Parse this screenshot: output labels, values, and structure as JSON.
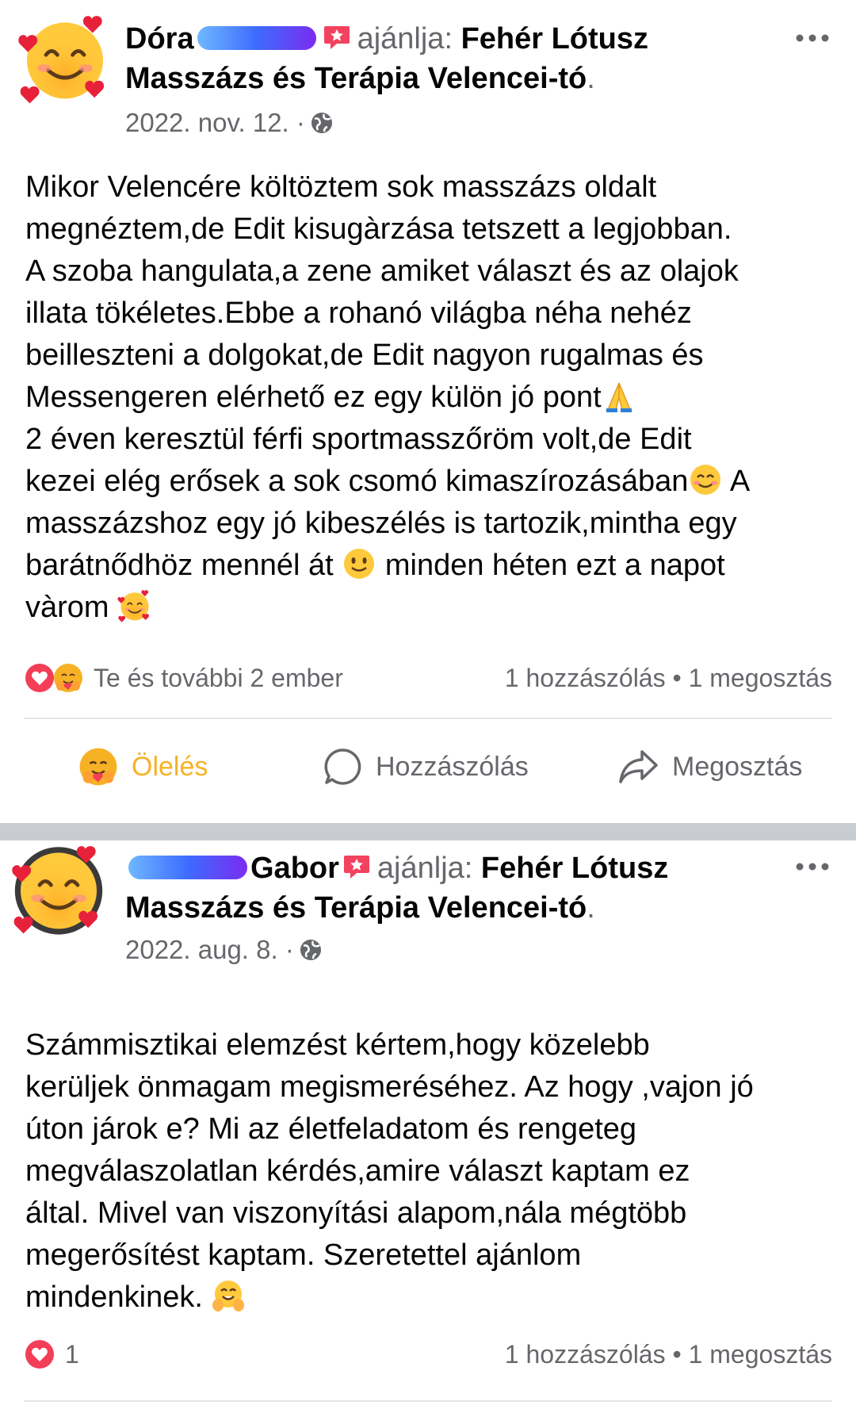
{
  "posts": [
    {
      "author_visible": "Dóra",
      "verb": "ajánlja:",
      "page": "Fehér Lótusz Masszázs és Terápia Velencei-tó",
      "end": ".",
      "date": "2022. nov. 12. ·",
      "body": [
        "Mikor Velencére költöztem sok masszázs oldalt",
        "megnéztem,de Edit kisugàrzása tetszett a legjobban.",
        "A szoba hangulata,a zene amiket választ és az olajok",
        "illata tökéletes.Ebbe a rohanó világba néha nehéz",
        "beilleszteni a dolgokat,de Edit nagyon rugalmas és",
        "Messengeren elérhető ez egy külön jó pont",
        "2 éven keresztül férfi sportmasszőröm volt,de Edit",
        "kezei elég erősek a sok csomó kimaszírozásában",
        "A",
        "masszázshoz egy jó kibeszélés is tartozik,mintha egy",
        "barátnődhöz mennél át",
        "minden héten ezt a napot",
        "vàrom"
      ],
      "reactions_text": "Te és további 2 ember",
      "comments": "1 hozzászólás",
      "bullet": "•",
      "shares": "1 megosztás",
      "actions": {
        "hug": "Ölelés",
        "comment": "Hozzászólás",
        "share": "Megosztás"
      }
    },
    {
      "author_visible": "Gabor",
      "verb": "ajánlja:",
      "page": "Fehér Lótusz Masszázs és Terápia Velencei-tó",
      "end": ".",
      "date": "2022. aug. 8. ·",
      "body": [
        "Számmisztikai elemzést kértem,hogy közelebb",
        "kerüljek önmagam megismeréséhez. Az hogy ,vajon jó",
        "úton járok e? Mi az életfeladatom és rengeteg",
        "megválaszolatlan kérdés,amire választ kaptam ez",
        "által. Mivel van viszonyítási alapom,nála mégtöbb",
        "megerősítést kaptam. Szeretettel ajánlom",
        "mindenkinek."
      ],
      "reactions_count": "1",
      "comments": "1 hozzászólás",
      "bullet": "•",
      "shares": "1 megosztás"
    }
  ],
  "colors": {
    "text": "#050505",
    "muted": "#65676b",
    "hug_accent": "#f7b125",
    "love_red": "#f33e58",
    "divider": "#c9ccd1"
  },
  "icons": [
    "smiling-face-with-hearts-icon",
    "recommendation-icon",
    "globe-icon",
    "more-icon",
    "folded-hands-icon",
    "smiling-face-icon",
    "slight-smile-icon",
    "love-reaction-icon",
    "care-reaction-icon",
    "comment-icon",
    "share-icon",
    "hugging-face-icon"
  ]
}
